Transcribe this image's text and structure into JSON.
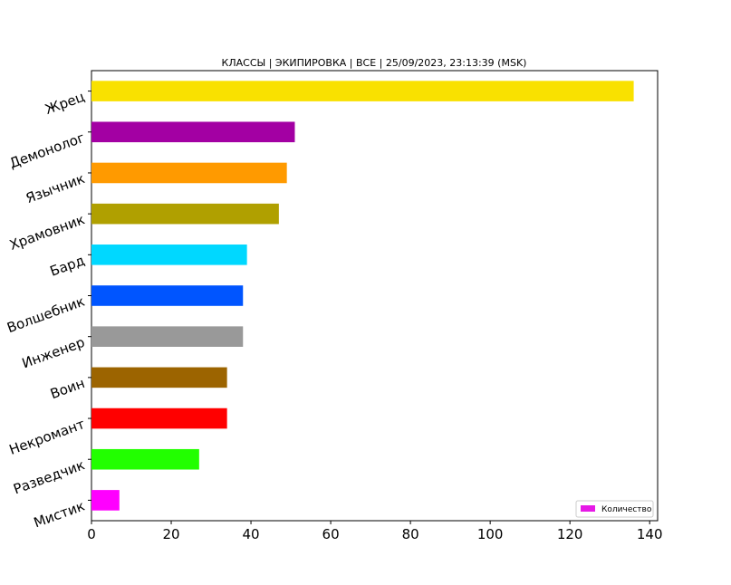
{
  "chart_data": {
    "type": "bar",
    "orientation": "horizontal",
    "title": "КЛАССЫ | ЭКИПИРОВКА | ВСЕ | 25/09/2023, 23:13:39 (MSK)",
    "xlabel": "",
    "ylabel": "",
    "xlim": [
      0,
      142
    ],
    "xticks": [
      0,
      20,
      40,
      60,
      80,
      100,
      120,
      140
    ],
    "grid": false,
    "legend": {
      "position": "bottom-right",
      "entries": [
        "Количество"
      ]
    },
    "categories": [
      "Жрец",
      "Демонолог",
      "Язычник",
      "Храмовник",
      "Бард",
      "Волшебник",
      "Инженер",
      "Воин",
      "Некромант",
      "Разведчик",
      "Мистик"
    ],
    "series": [
      {
        "name": "Количество",
        "values": [
          136,
          51,
          49,
          47,
          39,
          38,
          38,
          34,
          34,
          27,
          7
        ],
        "colors": [
          "#f9e100",
          "#a300a3",
          "#ff9a00",
          "#b0a000",
          "#00d8ff",
          "#0055ff",
          "#999999",
          "#9c6400",
          "#ff0000",
          "#22ff00",
          "#ff00ff"
        ]
      }
    ],
    "legend_color": "#e619e6"
  }
}
